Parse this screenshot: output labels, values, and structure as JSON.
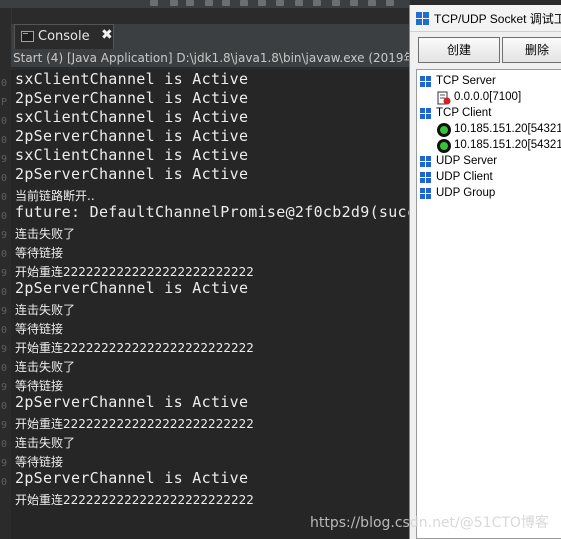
{
  "console": {
    "tab_label": "Console",
    "close_glyph": "✖",
    "launch_text": "Start (4) [Java Application] D:\\jdk1.8\\java1.8\\bin\\javaw.exe (2019年1",
    "lines": [
      "sxClientChannel is Active",
      "2pServerChannel is Active",
      "sxClientChannel is Active",
      "2pServerChannel is Active",
      "sxClientChannel is Active",
      "2pServerChannel is Active",
      "当前链路断开..",
      "future: DefaultChannelPromise@2f0cb2d9(succe",
      "连击失败了",
      "等待链接",
      "开始重连2222222222222222222222222",
      "2pServerChannel is Active",
      "连击失败了",
      "等待链接",
      "开始重连2222222222222222222222222",
      "连击失败了",
      "等待链接",
      "2pServerChannel is Active",
      "开始重连2222222222222222222222222",
      "连击失败了",
      "等待链接",
      "2pServerChannel is Active",
      "开始重连2222222222222222222222222"
    ]
  },
  "gutter": {
    "labels": [
      "0",
      "P",
      "0",
      "0",
      "9",
      "0",
      "0",
      "0",
      "9",
      "0",
      "9",
      "0",
      "9",
      "0",
      "9",
      "0",
      "9",
      "0",
      "9",
      "0",
      "9",
      "0"
    ]
  },
  "tool_window": {
    "title": "TCP/UDP Socket 调试工",
    "buttons": {
      "create": "创建",
      "delete": "删除"
    },
    "tree": {
      "tcp_server": "TCP Server",
      "tcp_server_child": "0.0.0.0[7100]",
      "tcp_client": "TCP Client",
      "tcp_client_children": [
        "10.185.151.20[54321]",
        "10.185.151.20[54321]"
      ],
      "udp_server": "UDP Server",
      "udp_client": "UDP Client",
      "udp_group": "UDP Group"
    }
  },
  "watermark": "https://blog.csdn.net/@51CTO博客"
}
